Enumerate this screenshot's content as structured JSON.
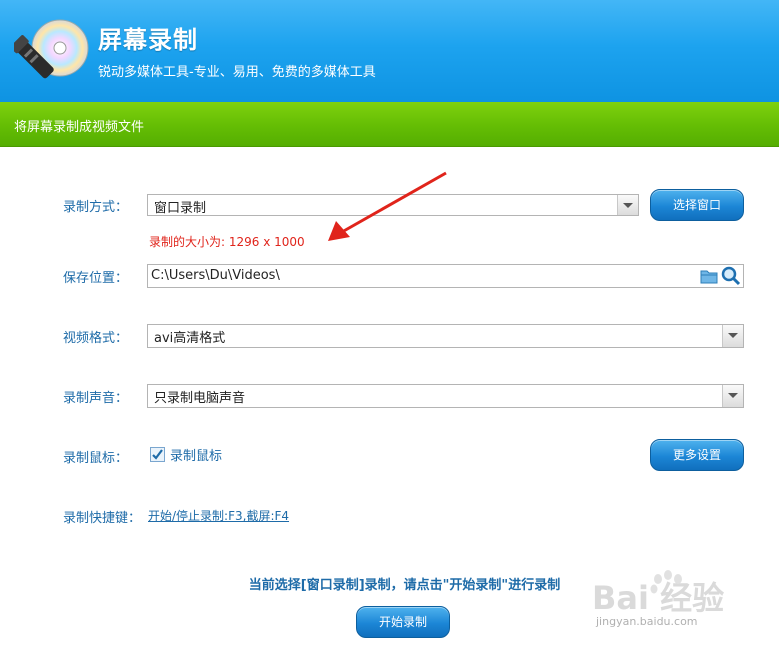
{
  "header": {
    "title": "屏幕录制",
    "subtitle": "锐动多媒体工具-专业、易用、免费的多媒体工具"
  },
  "subheader": {
    "title": "将屏幕录制成视频文件"
  },
  "form": {
    "mode_label": "录制方式：",
    "mode_value": "窗口录制",
    "select_window_button": "选择窗口",
    "size_info": "录制的大小为: 1296 x 1000",
    "save_label": "保存位置：",
    "save_path": "C:\\Users\\Du\\Videos\\",
    "format_label": "视频格式：",
    "format_value": "avi高清格式",
    "audio_label": "录制声音：",
    "audio_value": "只录制电脑声音",
    "mouse_label": "录制鼠标：",
    "mouse_checkbox_label": "录制鼠标",
    "mouse_checked": true,
    "more_settings_button": "更多设置",
    "hotkey_label": "录制快捷键：",
    "hotkey_value": "开始/停止录制:F3,截屏:F4"
  },
  "status_message": "当前选择[窗口录制]录制，请点击\"开始录制\"进行录制",
  "start_button": "开始录制",
  "watermark": {
    "brand": "Bai 经验",
    "url": "jingyan.baidu.com"
  },
  "colors": {
    "header_blue": "#1da3ef",
    "subheader_green": "#64bd04",
    "label_blue": "#1e6ba8",
    "annotation_red": "#e0241b"
  },
  "icons": [
    "cd-logo-icon",
    "folder-icon",
    "search-icon",
    "dropdown-arrow-icon",
    "checkbox-check-icon"
  ]
}
